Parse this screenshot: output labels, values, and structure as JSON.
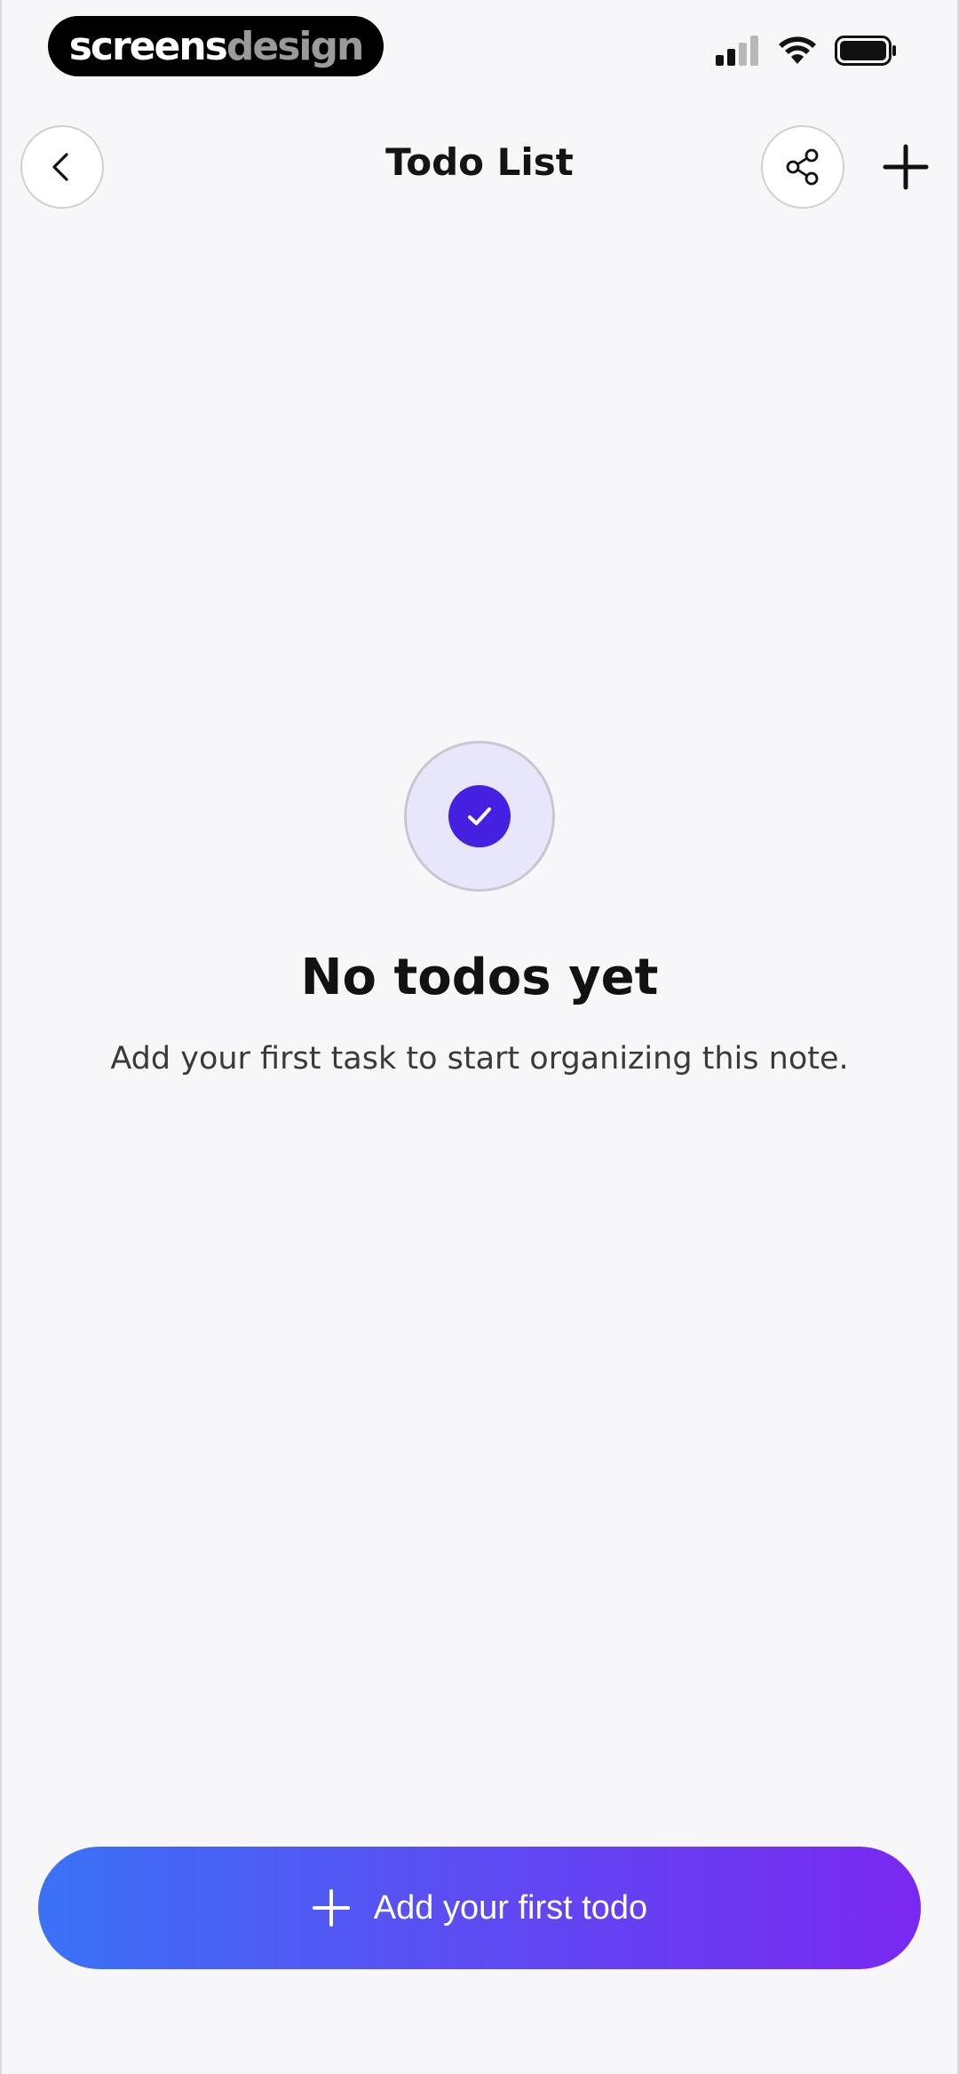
{
  "status_bar": {
    "watermark_part1": "screens",
    "watermark_part2": "design",
    "icons": [
      "signal-icon",
      "wifi-icon",
      "battery-icon"
    ]
  },
  "header": {
    "title": "Todo List",
    "back_icon": "chevron-left-icon",
    "share_icon": "share-icon",
    "add_icon": "plus-icon"
  },
  "empty_state": {
    "icon": "check-circle-icon",
    "title": "No todos yet",
    "subtitle": "Add your first task to start organizing this note."
  },
  "cta": {
    "label": "Add your first todo",
    "icon": "plus-icon"
  },
  "colors": {
    "background": "#f7f7f9",
    "accent": "#4421e0",
    "accent_light": "#e8e6fb",
    "gradient_start": "#3a72f6",
    "gradient_end": "#7a28f1"
  }
}
